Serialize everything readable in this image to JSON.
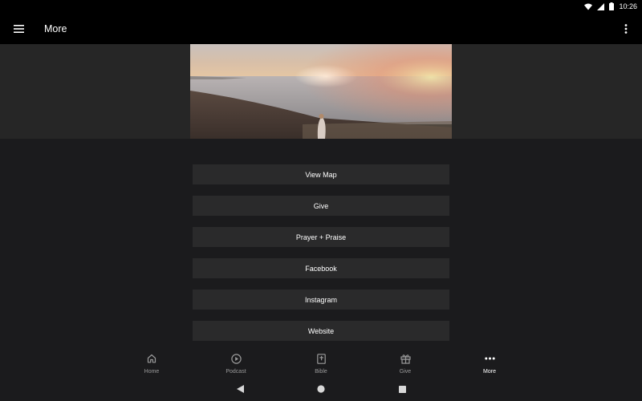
{
  "status_bar": {
    "time": "10:26"
  },
  "app_bar": {
    "title": "More"
  },
  "menu_items": [
    {
      "label": "View Map"
    },
    {
      "label": "Give"
    },
    {
      "label": "Prayer + Praise"
    },
    {
      "label": "Facebook"
    },
    {
      "label": "Instagram"
    },
    {
      "label": "Website"
    }
  ],
  "bottom_nav": [
    {
      "label": "Home",
      "icon": "home-icon"
    },
    {
      "label": "Podcast",
      "icon": "play-circle-icon"
    },
    {
      "label": "Bible",
      "icon": "bible-icon"
    },
    {
      "label": "Give",
      "icon": "gift-icon"
    },
    {
      "label": "More",
      "icon": "more-horizontal-icon",
      "active": true
    }
  ],
  "colors": {
    "background": "#1b1b1d",
    "app_bar": "#000000",
    "menu_item": "#2a2a2b",
    "inactive_label": "#9a9a9a"
  }
}
